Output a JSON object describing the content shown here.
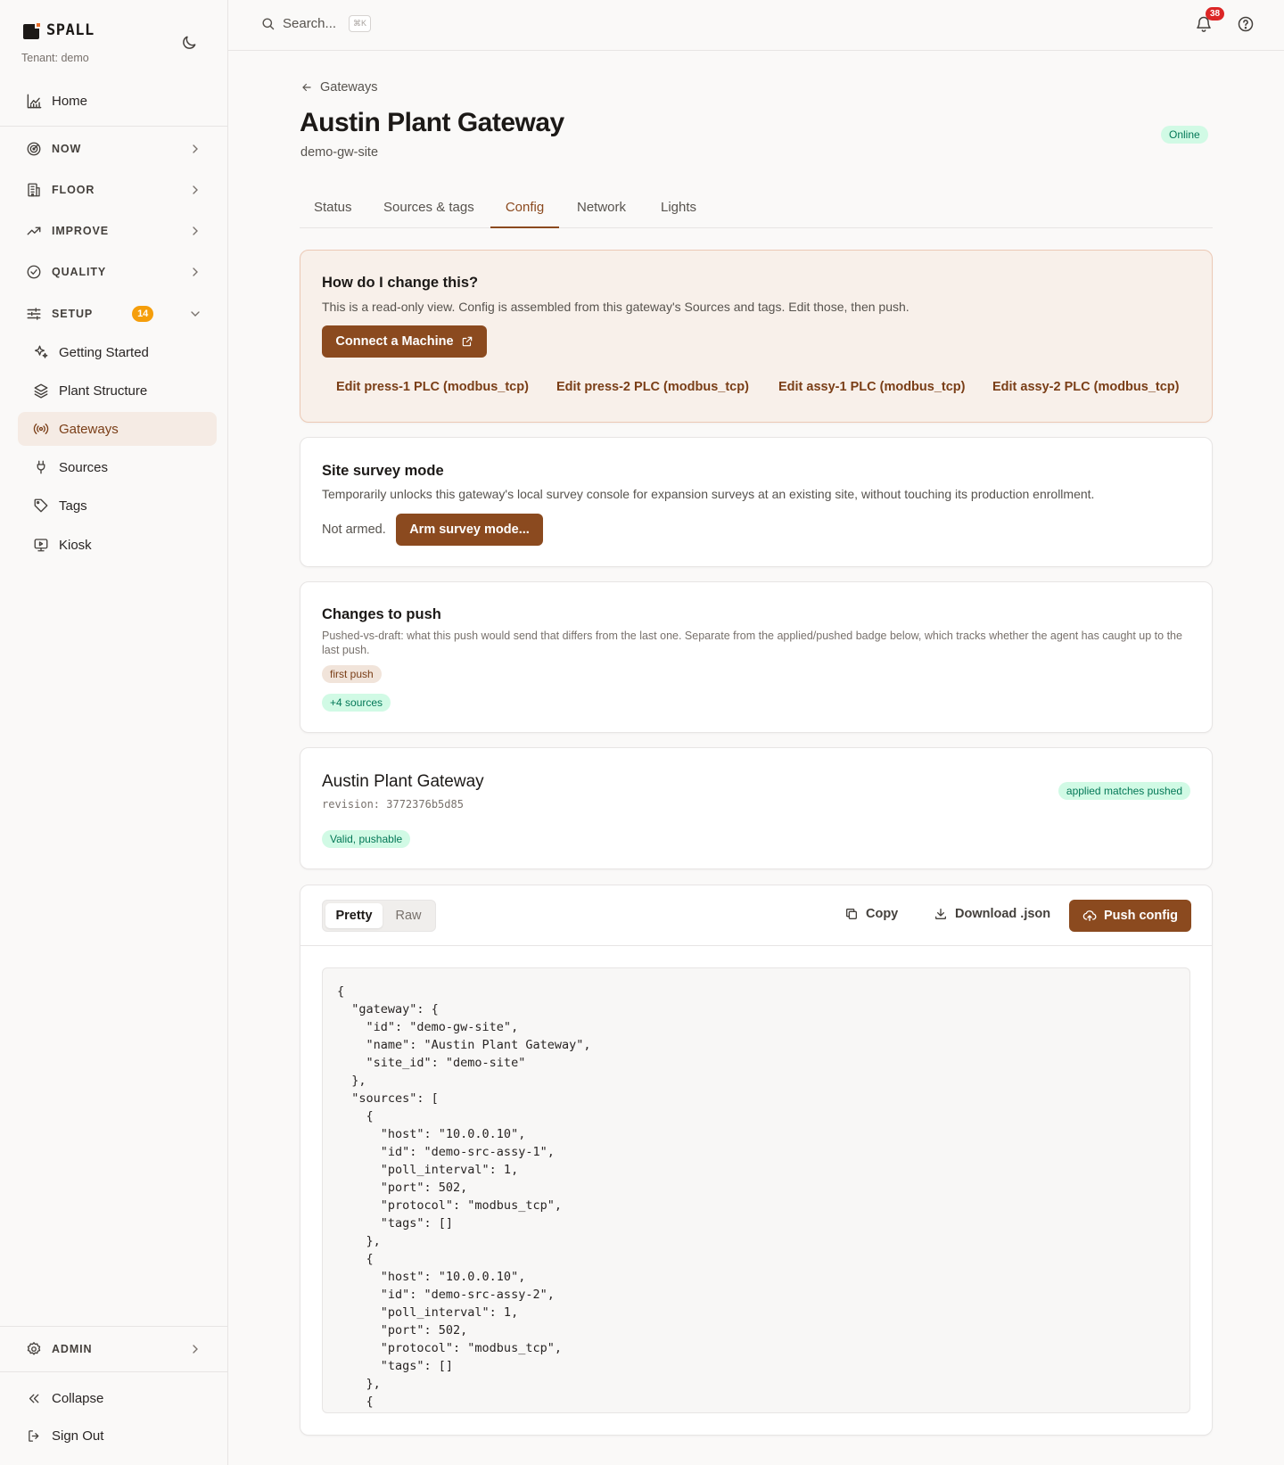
{
  "brand": {
    "name": "SPALL",
    "tenant": "Tenant: demo"
  },
  "sidebar": {
    "home": "Home",
    "sections": [
      {
        "label": "NOW"
      },
      {
        "label": "FLOOR"
      },
      {
        "label": "IMPROVE"
      },
      {
        "label": "QUALITY"
      },
      {
        "label": "SETUP",
        "badge": "14"
      }
    ],
    "setup_items": [
      {
        "label": "Getting Started",
        "icon": "sparkles-icon"
      },
      {
        "label": "Plant Structure",
        "icon": "layers-icon"
      },
      {
        "label": "Gateways",
        "icon": "broadcast-icon",
        "active": true
      },
      {
        "label": "Sources",
        "icon": "plug-icon"
      },
      {
        "label": "Tags",
        "icon": "tag-icon"
      },
      {
        "label": "Kiosk",
        "icon": "monitor-play-icon"
      }
    ],
    "admin": "ADMIN",
    "collapse": "Collapse",
    "sign_out": "Sign Out"
  },
  "topbar": {
    "search_placeholder": "Search...",
    "search_shortcut": "⌘K",
    "notification_count": "38"
  },
  "page": {
    "back_label": "Gateways",
    "title": "Austin Plant Gateway",
    "subtitle": "demo-gw-site",
    "status": "Online",
    "tabs": [
      "Status",
      "Sources & tags",
      "Config",
      "Network",
      "Lights"
    ],
    "active_tab": "Config"
  },
  "help_card": {
    "title": "How do I change this?",
    "description": "This is a read-only view. Config is assembled from this gateway's Sources and tags. Edit those, then push.",
    "connect_button": "Connect a Machine",
    "edit_links": [
      "Edit press-1 PLC (modbus_tcp)",
      "Edit press-2 PLC (modbus_tcp)",
      "Edit assy-1 PLC (modbus_tcp)",
      "Edit assy-2 PLC (modbus_tcp)"
    ]
  },
  "survey_card": {
    "title": "Site survey mode",
    "description": "Temporarily unlocks this gateway's local survey console for expansion surveys at an existing site, without touching its production enrollment.",
    "state": "Not armed.",
    "arm_button": "Arm survey mode..."
  },
  "changes_card": {
    "title": "Changes to push",
    "description": "Pushed-vs-draft: what this push would send that differs from the last one. Separate from the applied/pushed badge below, which tracks whether the agent has caught up to the last push.",
    "first_push": "first push",
    "sources_delta": "+4 sources"
  },
  "revision_card": {
    "title": "Austin Plant Gateway",
    "revision": "revision: 3772376b5d85",
    "sync_badge": "applied matches pushed",
    "valid_badge": "Valid, pushable"
  },
  "config_view": {
    "modes": [
      "Pretty",
      "Raw"
    ],
    "active_mode": "Pretty",
    "copy": "Copy",
    "download": "Download .json",
    "push": "Push config",
    "code": "{\n  \"gateway\": {\n    \"id\": \"demo-gw-site\",\n    \"name\": \"Austin Plant Gateway\",\n    \"site_id\": \"demo-site\"\n  },\n  \"sources\": [\n    {\n      \"host\": \"10.0.0.10\",\n      \"id\": \"demo-src-assy-1\",\n      \"poll_interval\": 1,\n      \"port\": 502,\n      \"protocol\": \"modbus_tcp\",\n      \"tags\": []\n    },\n    {\n      \"host\": \"10.0.0.10\",\n      \"id\": \"demo-src-assy-2\",\n      \"poll_interval\": 1,\n      \"port\": 502,\n      \"protocol\": \"modbus_tcp\",\n      \"tags\": []\n    },\n    {"
  },
  "colors": {
    "accent": "#8b4a1f",
    "active_bg": "#f5ebe4",
    "online": "#047857",
    "setup_badge": "#f59e0b",
    "notification": "#dc2626"
  }
}
